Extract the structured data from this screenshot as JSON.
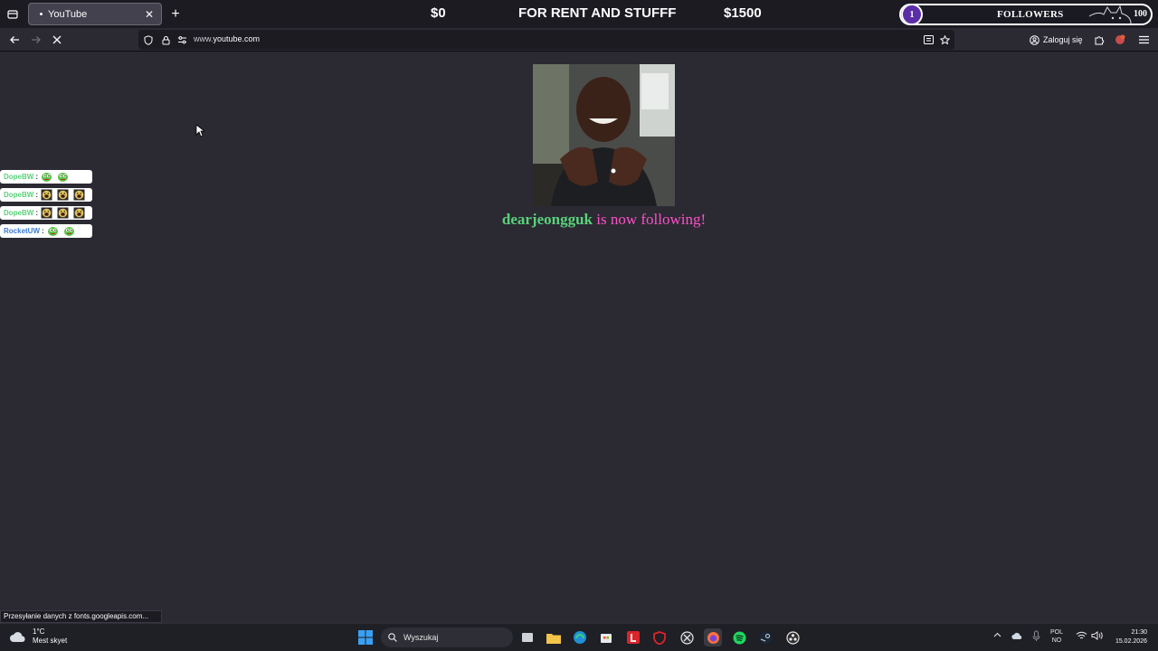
{
  "browser": {
    "tab": {
      "title": "YouTube"
    },
    "url": {
      "prefix": "www.",
      "host": "youtube.com"
    },
    "login_label": "Zaloguj się",
    "status_tip": "Przesyłanie danych z fonts.googleapis.com..."
  },
  "overlay": {
    "goal": {
      "left": "$0",
      "title": "FOR RENT AND STUFFF",
      "right": "$1500"
    },
    "followers": {
      "current": "1",
      "label": "FOLLOWERS",
      "target": "100",
      "progress": 0.01
    }
  },
  "alert": {
    "username": "dearjeongguk",
    "message": " is now following!"
  },
  "chat": [
    {
      "user": "DopeBW",
      "sep": ":",
      "emotes": [
        "pepe-emote",
        "pepe-emote"
      ],
      "color": "#5ad27a"
    },
    {
      "user": "DopeBW",
      "sep": ":",
      "emotes": [
        "kekw-emote",
        "kekw-emote",
        "kekw-emote"
      ],
      "color": "#5ad27a"
    },
    {
      "user": "DopeBW",
      "sep": ":",
      "emotes": [
        "kekw-emote",
        "kekw-emote",
        "kekw-emote"
      ],
      "color": "#5ad27a"
    },
    {
      "user": "RocketUW",
      "sep": ":",
      "emotes": [
        "pepe-emote",
        "pepe-emote"
      ],
      "color": "#3a7bd5"
    }
  ],
  "taskbar": {
    "weather": {
      "temp": "1°C",
      "desc": "Mest skyet"
    },
    "search_placeholder": "Wyszukaj",
    "lang": {
      "top": "POL",
      "bottom": "NO"
    },
    "clock": {
      "time": "21:30",
      "date": "15.02.2026"
    }
  },
  "colors": {
    "background": "#2b2a33",
    "chrome": "#1c1b22",
    "accent_purple": "#6b3bbd"
  }
}
